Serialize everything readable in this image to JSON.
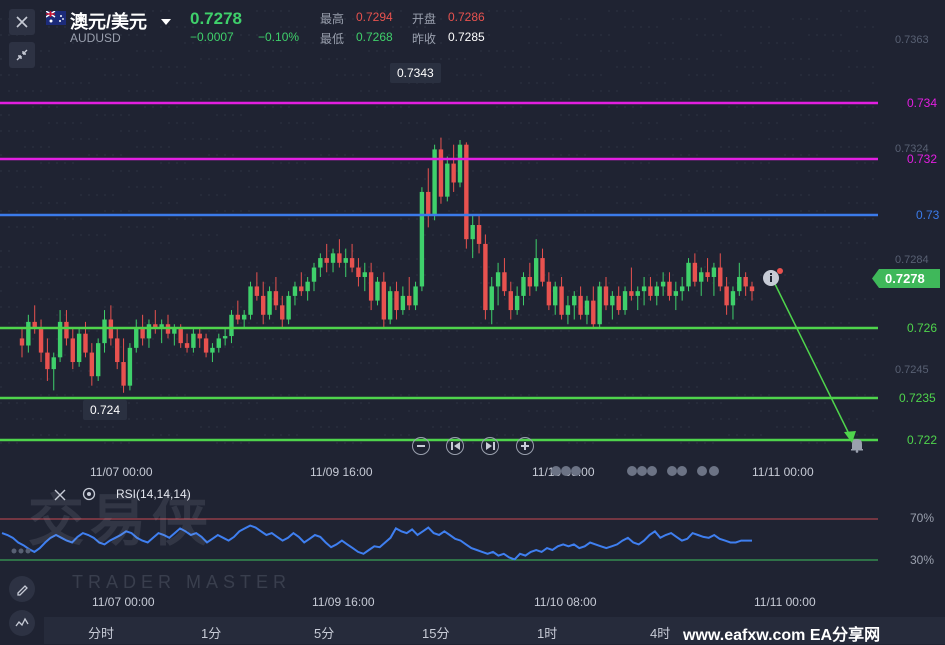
{
  "header": {
    "title": "澳元/美元",
    "symbol": "AUDUSD",
    "price": "0.7278",
    "change": "−0.0007",
    "change_pct": "−0.10%",
    "high_label": "最高",
    "high": "0.7294",
    "open_label": "开盘",
    "open": "0.7286",
    "low_label": "最低",
    "low": "0.7268",
    "prev_label": "昨收",
    "prev": "0.7285"
  },
  "price_axis": {
    "ticks": [
      "0.7363",
      "0.7324",
      "0.7284",
      "0.7245"
    ],
    "current_tag": "0.7278"
  },
  "levels": [
    {
      "label": "0.734",
      "value": 0.734,
      "color": "#e21fe0"
    },
    {
      "label": "0.732",
      "value": 0.732,
      "color": "#e21fe0"
    },
    {
      "label": "0.73",
      "value": 0.73,
      "color": "#3b7bea"
    },
    {
      "label": "0.726",
      "value": 0.726,
      "color": "#4fd44c"
    },
    {
      "label": "0.7235",
      "value": 0.7235,
      "color": "#4fd44c"
    },
    {
      "label": "0.722",
      "value": 0.722,
      "color": "#4fd44c"
    }
  ],
  "callouts": {
    "high_value": "0.7343",
    "low_value": "0.724"
  },
  "time_axis": [
    "11/07 00:00",
    "11/09 16:00",
    "11/10 08:00",
    "11/11 00:00"
  ],
  "rsi": {
    "title": "RSI(14,14,14)",
    "levels": [
      "70%",
      "30%"
    ],
    "values": [
      60,
      58,
      55,
      50,
      47,
      43,
      40,
      44,
      50,
      55,
      58,
      55,
      52,
      50,
      56,
      60,
      58,
      55,
      50,
      48,
      52,
      55,
      58,
      62,
      60,
      55,
      52,
      50,
      55,
      60,
      58,
      55,
      60,
      65,
      62,
      58,
      60,
      56,
      50,
      54,
      58,
      55,
      52,
      56,
      62,
      65,
      68,
      66,
      62,
      58,
      60,
      56,
      52,
      55,
      60,
      56,
      50,
      54,
      58,
      56,
      50,
      45,
      48,
      52,
      48,
      44,
      40,
      38,
      42,
      46,
      45,
      50,
      55,
      65,
      62,
      60,
      64,
      58,
      62,
      66,
      60,
      58,
      62,
      58,
      54,
      52,
      48,
      44,
      42,
      40,
      38,
      40,
      36,
      38,
      34,
      32,
      38,
      36,
      40,
      42,
      40,
      44,
      42,
      46,
      48,
      46,
      48,
      44,
      46,
      50,
      48,
      46,
      44,
      46,
      48,
      52,
      55,
      50,
      48,
      52,
      58,
      62,
      55,
      58,
      60,
      56,
      52,
      54,
      60,
      58,
      56,
      55,
      58,
      54,
      52,
      50,
      50,
      52,
      52,
      52
    ],
    "times": [
      "11/07 00:00",
      "11/09 16:00",
      "11/10 08:00",
      "11/11 00:00"
    ]
  },
  "controls": [
    "zoom-out",
    "step-back",
    "step-forward",
    "zoom-in"
  ],
  "timeframes": [
    "分时",
    "1分",
    "5分",
    "15分",
    "1时",
    "4时"
  ],
  "watermark": {
    "brand": "交易侠",
    "sub": "TRADER MASTER"
  },
  "footer_watermark": "www.eafxw.com  EA分享网",
  "colors": {
    "up": "#3fd06b",
    "down": "#e8524f",
    "rsi": "#3f7ff0",
    "bg": "#1f2332"
  },
  "chart_data": {
    "type": "candlestick",
    "ylim": [
      0.7215,
      0.7375
    ],
    "candles": [
      [
        0.7258,
        0.7262,
        0.725,
        0.7255
      ],
      [
        0.7255,
        0.7268,
        0.7252,
        0.7265
      ],
      [
        0.7265,
        0.7272,
        0.726,
        0.7262
      ],
      [
        0.7262,
        0.7266,
        0.7248,
        0.7252
      ],
      [
        0.7252,
        0.7258,
        0.724,
        0.7245
      ],
      [
        0.7245,
        0.7252,
        0.7236,
        0.725
      ],
      [
        0.725,
        0.727,
        0.7248,
        0.7265
      ],
      [
        0.7265,
        0.727,
        0.7255,
        0.7258
      ],
      [
        0.7258,
        0.7262,
        0.7245,
        0.7248
      ],
      [
        0.7248,
        0.7262,
        0.7246,
        0.726
      ],
      [
        0.726,
        0.7265,
        0.725,
        0.7252
      ],
      [
        0.7252,
        0.7256,
        0.7238,
        0.7242
      ],
      [
        0.7242,
        0.7258,
        0.724,
        0.7256
      ],
      [
        0.7256,
        0.727,
        0.7252,
        0.7266
      ],
      [
        0.7266,
        0.7272,
        0.7255,
        0.7258
      ],
      [
        0.7258,
        0.7262,
        0.7245,
        0.7248
      ],
      [
        0.7248,
        0.7258,
        0.7235,
        0.7238
      ],
      [
        0.7238,
        0.7256,
        0.7236,
        0.7254
      ],
      [
        0.7254,
        0.7266,
        0.7252,
        0.7262
      ],
      [
        0.7262,
        0.7268,
        0.7255,
        0.7258
      ],
      [
        0.7258,
        0.7266,
        0.7254,
        0.7264
      ],
      [
        0.7264,
        0.727,
        0.726,
        0.7262
      ],
      [
        0.7262,
        0.7266,
        0.7256,
        0.7264
      ],
      [
        0.7264,
        0.7268,
        0.7258,
        0.726
      ],
      [
        0.726,
        0.7264,
        0.7255,
        0.7262
      ],
      [
        0.7262,
        0.7264,
        0.7254,
        0.7256
      ],
      [
        0.7256,
        0.726,
        0.7252,
        0.7254
      ],
      [
        0.7254,
        0.7262,
        0.7252,
        0.726
      ],
      [
        0.726,
        0.7262,
        0.7254,
        0.7258
      ],
      [
        0.7258,
        0.726,
        0.725,
        0.7252
      ],
      [
        0.7252,
        0.7256,
        0.7248,
        0.7254
      ],
      [
        0.7254,
        0.726,
        0.7252,
        0.7258
      ],
      [
        0.7258,
        0.7262,
        0.7255,
        0.7259
      ],
      [
        0.7259,
        0.727,
        0.7256,
        0.7268
      ],
      [
        0.7268,
        0.7274,
        0.7264,
        0.7266
      ],
      [
        0.7266,
        0.727,
        0.7262,
        0.7268
      ],
      [
        0.7268,
        0.7282,
        0.7266,
        0.728
      ],
      [
        0.728,
        0.7286,
        0.7274,
        0.7276
      ],
      [
        0.7276,
        0.7282,
        0.7264,
        0.7268
      ],
      [
        0.7268,
        0.728,
        0.7266,
        0.7278
      ],
      [
        0.7278,
        0.7284,
        0.727,
        0.7272
      ],
      [
        0.7272,
        0.7276,
        0.7262,
        0.7266
      ],
      [
        0.7266,
        0.7278,
        0.7264,
        0.7276
      ],
      [
        0.7276,
        0.7282,
        0.7272,
        0.728
      ],
      [
        0.728,
        0.7286,
        0.7276,
        0.7278
      ],
      [
        0.7278,
        0.7284,
        0.7274,
        0.7282
      ],
      [
        0.7282,
        0.729,
        0.7278,
        0.7288
      ],
      [
        0.7288,
        0.7294,
        0.7284,
        0.7292
      ],
      [
        0.7292,
        0.7298,
        0.7286,
        0.729
      ],
      [
        0.729,
        0.7296,
        0.7286,
        0.7294
      ],
      [
        0.7294,
        0.73,
        0.7288,
        0.729
      ],
      [
        0.729,
        0.7296,
        0.7284,
        0.7292
      ],
      [
        0.7292,
        0.7298,
        0.7286,
        0.7288
      ],
      [
        0.7288,
        0.7292,
        0.728,
        0.7284
      ],
      [
        0.7284,
        0.729,
        0.7278,
        0.7286
      ],
      [
        0.7286,
        0.729,
        0.727,
        0.7274
      ],
      [
        0.7274,
        0.7284,
        0.7272,
        0.7282
      ],
      [
        0.7282,
        0.7286,
        0.7262,
        0.7266
      ],
      [
        0.7266,
        0.728,
        0.7264,
        0.7278
      ],
      [
        0.7278,
        0.7282,
        0.7266,
        0.727
      ],
      [
        0.727,
        0.728,
        0.7268,
        0.7276
      ],
      [
        0.7276,
        0.7284,
        0.727,
        0.7272
      ],
      [
        0.7272,
        0.7282,
        0.727,
        0.728
      ],
      [
        0.728,
        0.7322,
        0.7278,
        0.732
      ],
      [
        0.732,
        0.733,
        0.7305,
        0.731
      ],
      [
        0.731,
        0.734,
        0.7308,
        0.7338
      ],
      [
        0.7338,
        0.7343,
        0.7315,
        0.7318
      ],
      [
        0.7318,
        0.7335,
        0.7316,
        0.7332
      ],
      [
        0.7332,
        0.734,
        0.732,
        0.7324
      ],
      [
        0.7324,
        0.7342,
        0.7322,
        0.734
      ],
      [
        0.734,
        0.7341,
        0.7296,
        0.73
      ],
      [
        0.73,
        0.731,
        0.7292,
        0.7306
      ],
      [
        0.7306,
        0.731,
        0.7294,
        0.7298
      ],
      [
        0.7298,
        0.7302,
        0.7266,
        0.727
      ],
      [
        0.727,
        0.7284,
        0.7264,
        0.728
      ],
      [
        0.728,
        0.729,
        0.7272,
        0.7286
      ],
      [
        0.7286,
        0.7292,
        0.7276,
        0.7278
      ],
      [
        0.7278,
        0.7282,
        0.7266,
        0.727
      ],
      [
        0.727,
        0.728,
        0.7268,
        0.7276
      ],
      [
        0.7276,
        0.7286,
        0.7272,
        0.7284
      ],
      [
        0.7284,
        0.729,
        0.7276,
        0.728
      ],
      [
        0.728,
        0.73,
        0.7278,
        0.7292
      ],
      [
        0.7292,
        0.7296,
        0.728,
        0.7282
      ],
      [
        0.7282,
        0.7286,
        0.727,
        0.7272
      ],
      [
        0.7272,
        0.7282,
        0.7268,
        0.728
      ],
      [
        0.728,
        0.7284,
        0.7266,
        0.7268
      ],
      [
        0.7268,
        0.7276,
        0.7264,
        0.7272
      ],
      [
        0.7272,
        0.7278,
        0.7266,
        0.7276
      ],
      [
        0.7276,
        0.728,
        0.7266,
        0.7268
      ],
      [
        0.7268,
        0.7276,
        0.7264,
        0.7274
      ],
      [
        0.7274,
        0.728,
        0.7262,
        0.7264
      ],
      [
        0.7264,
        0.7282,
        0.7262,
        0.728
      ],
      [
        0.728,
        0.7284,
        0.727,
        0.7272
      ],
      [
        0.7272,
        0.7278,
        0.7266,
        0.7276
      ],
      [
        0.7276,
        0.728,
        0.7268,
        0.727
      ],
      [
        0.727,
        0.728,
        0.7268,
        0.7278
      ],
      [
        0.7278,
        0.7288,
        0.7274,
        0.7276
      ],
      [
        0.7276,
        0.728,
        0.727,
        0.7278
      ],
      [
        0.7278,
        0.7284,
        0.7272,
        0.728
      ],
      [
        0.728,
        0.7284,
        0.7274,
        0.7276
      ],
      [
        0.7276,
        0.7282,
        0.7272,
        0.728
      ],
      [
        0.728,
        0.7286,
        0.7276,
        0.7282
      ],
      [
        0.7282,
        0.7286,
        0.7274,
        0.7276
      ],
      [
        0.7276,
        0.7282,
        0.727,
        0.7278
      ],
      [
        0.7278,
        0.7284,
        0.7274,
        0.728
      ],
      [
        0.728,
        0.7292,
        0.7278,
        0.729
      ],
      [
        0.729,
        0.7294,
        0.728,
        0.7282
      ],
      [
        0.7282,
        0.7288,
        0.7276,
        0.7286
      ],
      [
        0.7286,
        0.7292,
        0.7282,
        0.7284
      ],
      [
        0.7284,
        0.729,
        0.7276,
        0.7288
      ],
      [
        0.7288,
        0.7294,
        0.7278,
        0.728
      ],
      [
        0.728,
        0.7284,
        0.7268,
        0.7272
      ],
      [
        0.7272,
        0.728,
        0.7266,
        0.7278
      ],
      [
        0.7278,
        0.729,
        0.7276,
        0.7284
      ],
      [
        0.7284,
        0.7286,
        0.7276,
        0.728
      ],
      [
        0.728,
        0.7282,
        0.7274,
        0.7278
      ]
    ]
  }
}
